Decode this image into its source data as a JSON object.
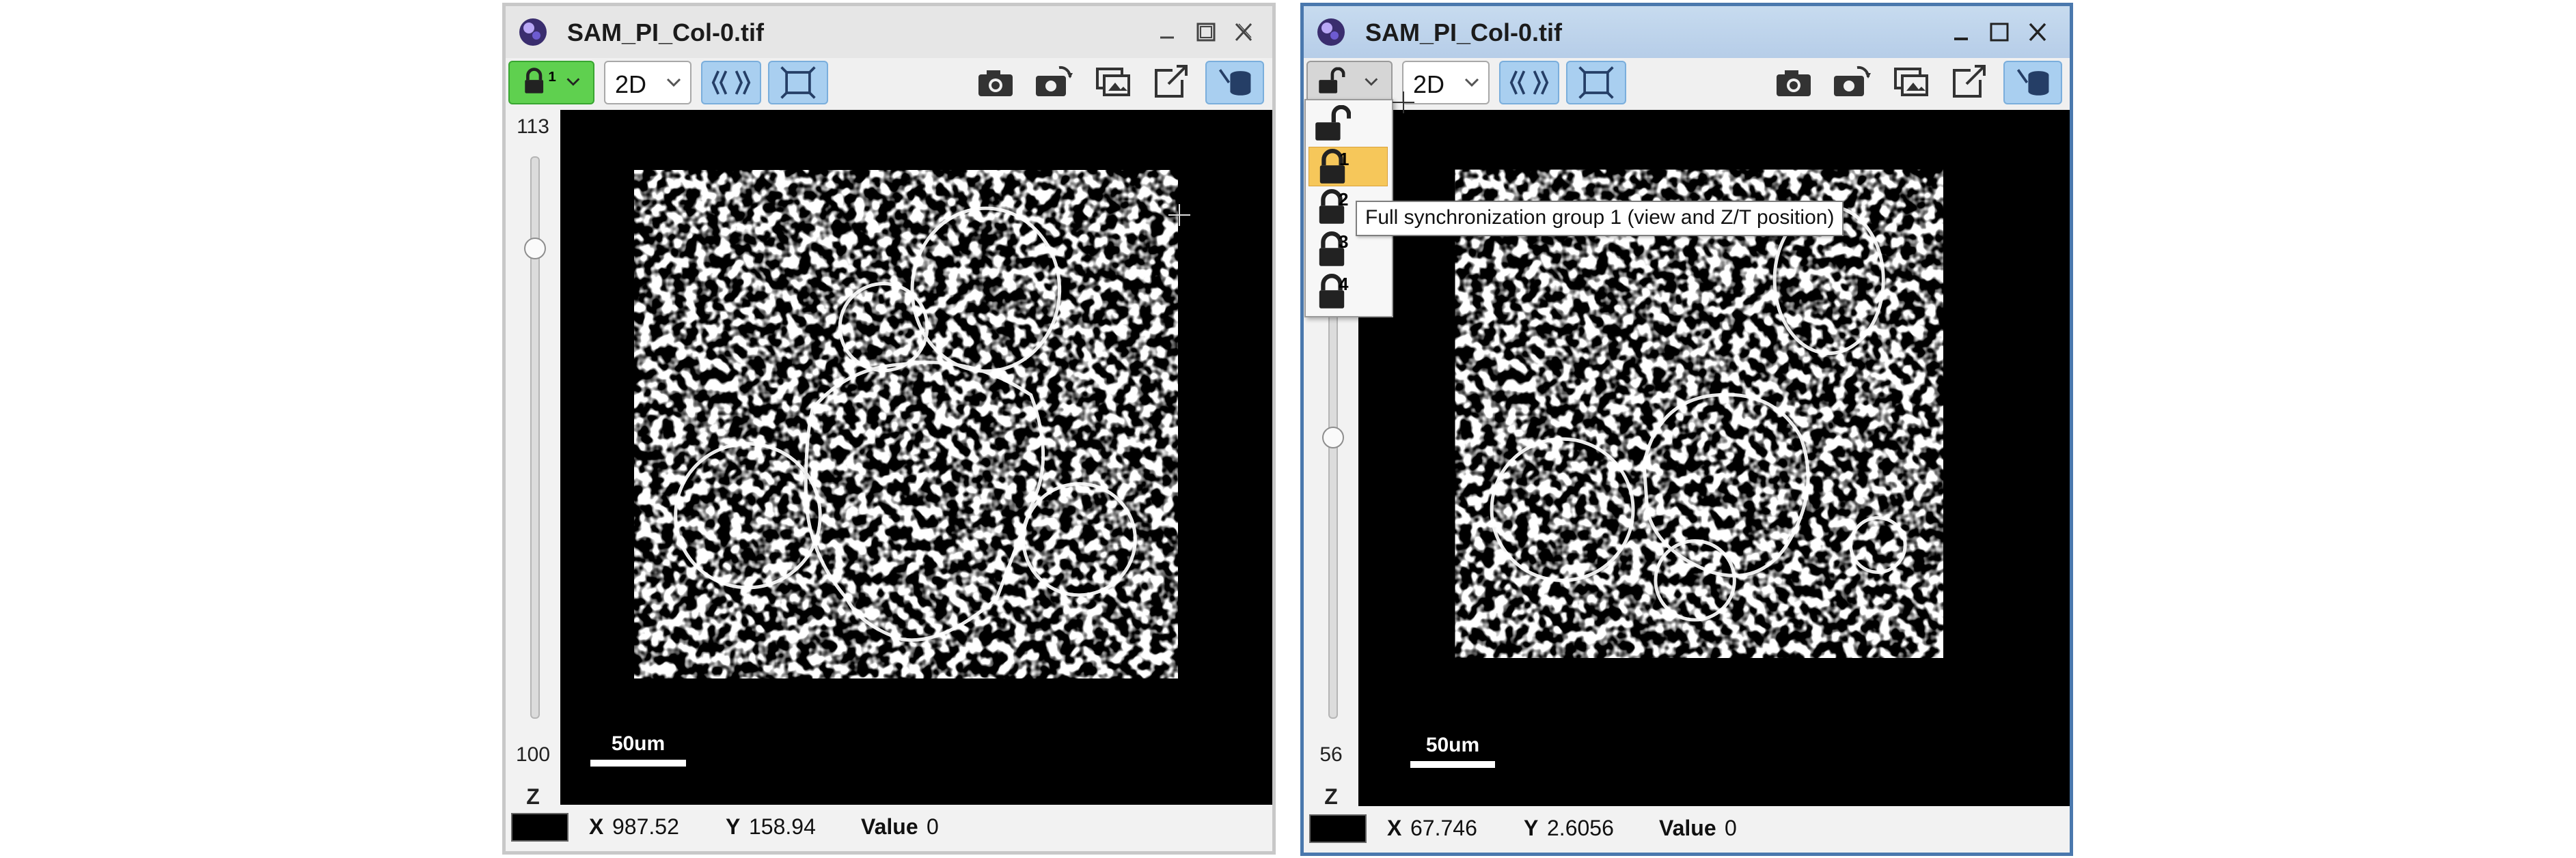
{
  "windows": [
    {
      "title": "SAM_PI_Col-0.tif",
      "lock_group": "1",
      "view_mode": "2D",
      "z_max": "113",
      "z_min": "100",
      "z_label": "Z",
      "z_position": 0.15,
      "scale_bar": "50um",
      "status": {
        "x_label": "X",
        "x_value": "987.52",
        "y_label": "Y",
        "y_value": "158.94",
        "value_label": "Value",
        "value": "0"
      }
    },
    {
      "title": "SAM_PI_Col-0.tif",
      "lock_group": "",
      "view_mode": "2D",
      "z_max": "",
      "z_min": "56",
      "z_label": "Z",
      "z_position": 0.5,
      "scale_bar": "50um",
      "status": {
        "x_label": "X",
        "x_value": "67.746",
        "y_label": "Y",
        "y_value": "2.6056",
        "value_label": "Value",
        "value": "0"
      }
    }
  ],
  "lock_menu": {
    "items": [
      {
        "number": "",
        "icon": "unlock-icon"
      },
      {
        "number": "1",
        "icon": "lock-icon",
        "selected": true
      },
      {
        "number": "2",
        "icon": "lock-icon"
      },
      {
        "number": "3",
        "icon": "lock-icon"
      },
      {
        "number": "4",
        "icon": "lock-icon"
      }
    ]
  },
  "tooltip": "Full synchronization group 1 (view and Z/T position)",
  "colors": {
    "lock_active": "#5fd04f",
    "active_title": "#4a78ad",
    "menu_selected": "#f6c75a",
    "toggle_on": "#a9cff0"
  },
  "icons": [
    "app-icon",
    "minimize-icon",
    "maximize-icon",
    "close-icon",
    "lock-icon",
    "chevron-down-icon",
    "layers-icon",
    "fit-window-icon",
    "camera-icon",
    "camera-all-icon",
    "duplicate-icon",
    "external-icon",
    "persistent-icon",
    "crosshair-cursor-icon"
  ]
}
